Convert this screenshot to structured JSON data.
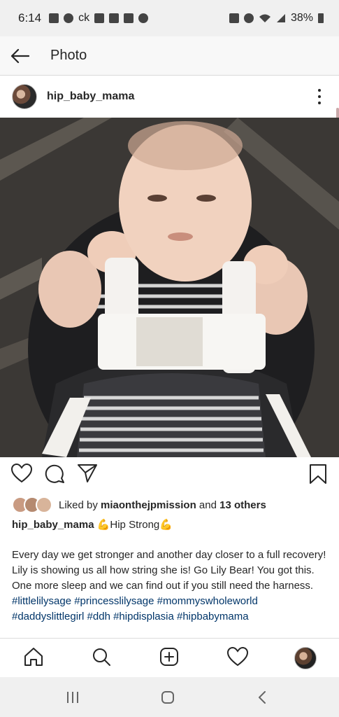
{
  "status_bar": {
    "time": "6:14",
    "carrier_text": "ck",
    "battery": "38%",
    "notification_icons": [
      "facebook-icon",
      "messenger-icon",
      "facebook-icon",
      "news-icon",
      "gallery-icon",
      "phone-icon"
    ],
    "system_icons": [
      "nfc-icon",
      "alarm-icon",
      "wifi-icon",
      "signal-icon",
      "battery-icon"
    ]
  },
  "app_bar": {
    "title": "Photo"
  },
  "post": {
    "username": "hip_baby_mama",
    "liked_by_prefix": "Liked by",
    "liked_by_user": "miaonthejpmission",
    "liked_by_and": "and",
    "liked_by_others": "13 others",
    "caption_user": "hip_baby_mama",
    "caption_headline": "💪Hip Strong💪",
    "caption_body": "Every day we get stronger and another day closer to a full recovery! Lily is showing us all how string she is! Go Lily Bear! You got this. One more sleep and we can find out if you still need the harness.",
    "hashtags_line1": "#littlelilysage #princesslilysage #mommyswholeworld",
    "hashtags_line2": "#daddyslittlegirl #ddh #hipdisplasia #hipbabymama"
  },
  "colors": {
    "text": "#262626",
    "hashtag": "#003569",
    "status_bg": "#f0f0f0",
    "divider": "#dbdbdb"
  }
}
